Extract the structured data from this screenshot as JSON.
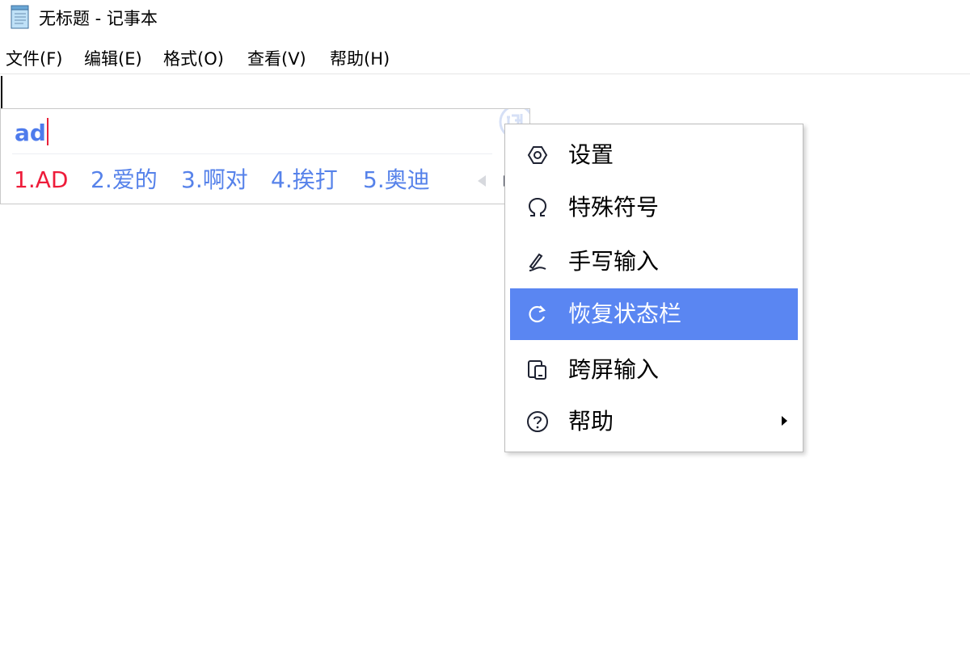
{
  "window": {
    "title": "无标题 - 记事本",
    "icon": "notepad-icon"
  },
  "menu": {
    "items": [
      {
        "label": "文件(F)"
      },
      {
        "label": "编辑(E)"
      },
      {
        "label": "格式(O)"
      },
      {
        "label": "查看(V)"
      },
      {
        "label": "帮助(H)"
      }
    ]
  },
  "ime": {
    "input": "ad",
    "logo_icon": "ime-brand-logo-icon",
    "candidates": [
      {
        "label": "1.AD"
      },
      {
        "label": "2.爱的"
      },
      {
        "label": "3.啊对"
      },
      {
        "label": "4.挨打"
      },
      {
        "label": "5.奥迪"
      }
    ],
    "colors": {
      "input": "#4e7bec",
      "first_candidate": "#ee1c3a",
      "candidate": "#5682ea"
    }
  },
  "context_menu": {
    "items": [
      {
        "label": "设置",
        "icon": "settings-icon"
      },
      {
        "label": "特殊符号",
        "icon": "omega-icon"
      },
      {
        "label": "手写输入",
        "icon": "pen-icon"
      },
      {
        "label": "恢复状态栏",
        "icon": "refresh-icon",
        "highlighted": true
      },
      {
        "label": "跨屏输入",
        "icon": "cross-screen-icon"
      },
      {
        "label": "帮助",
        "icon": "help-circle-icon",
        "has_submenu": true
      }
    ],
    "highlight_color": "#5a86f2"
  }
}
